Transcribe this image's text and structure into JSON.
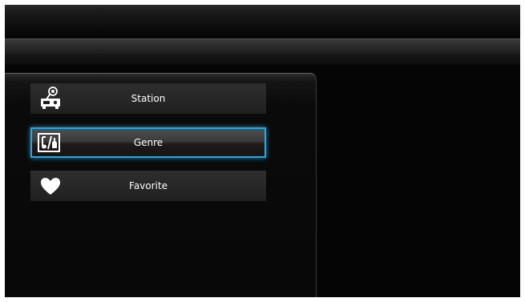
{
  "menu": {
    "items": [
      {
        "label": "Station",
        "icon": "radio-station-icon",
        "selected": false
      },
      {
        "label": "Genre",
        "icon": "music-genre-icon",
        "selected": true
      },
      {
        "label": "Favorite",
        "icon": "heart-icon",
        "selected": false
      }
    ]
  },
  "colors": {
    "selection_border": "#2aa6e0",
    "background": "#050505"
  }
}
